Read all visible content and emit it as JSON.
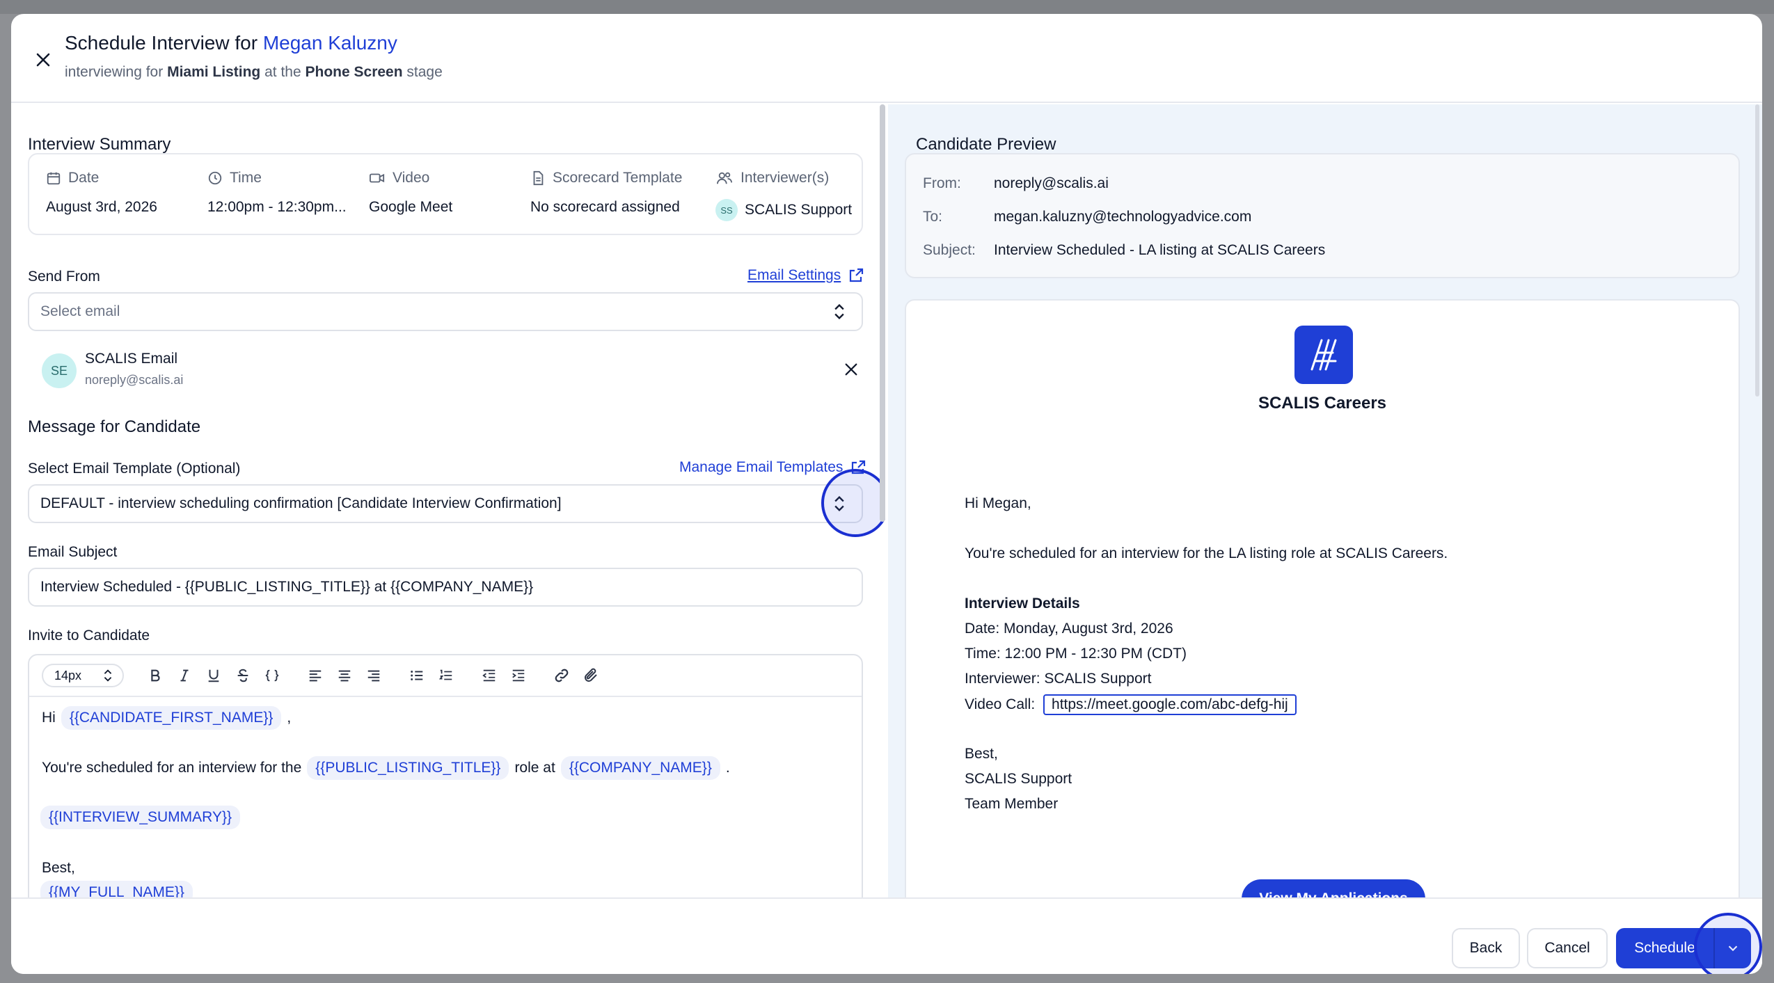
{
  "header": {
    "title_prefix": "Schedule Interview for",
    "candidate_name": "Megan Kaluzny",
    "subtitle_pre": "interviewing for",
    "listing": "Miami Listing",
    "subtitle_mid": "at the",
    "stage": "Phone Screen",
    "subtitle_post": "stage"
  },
  "summary": {
    "title": "Interview Summary",
    "date_label": "Date",
    "date_value": "August 3rd, 2026",
    "time_label": "Time",
    "time_value": "12:00pm - 12:30pm...",
    "video_label": "Video",
    "video_value": "Google Meet",
    "scorecard_label": "Scorecard Template",
    "scorecard_value": "No scorecard assigned",
    "interviewers_label": "Interviewer(s)",
    "interviewer_initials": "SS",
    "interviewer_name": "SCALIS Support"
  },
  "send_from": {
    "label": "Send From",
    "settings_link": "Email Settings",
    "placeholder": "Select email",
    "sender_initials": "SE",
    "sender_name": "SCALIS Email",
    "sender_email": "noreply@scalis.ai"
  },
  "message": {
    "title": "Message for Candidate",
    "template_label": "Select Email Template (Optional)",
    "templates_link": "Manage Email Templates",
    "template_value": "DEFAULT - interview scheduling confirmation [Candidate Interview Confirmation]",
    "subject_label": "Email Subject",
    "subject_value": "Interview Scheduled - {{PUBLIC_LISTING_TITLE}} at {{COMPANY_NAME}}",
    "invite_label": "Invite to Candidate"
  },
  "editor": {
    "font_size": "14px",
    "line1_pre": "Hi",
    "token_first_name": "{{CANDIDATE_FIRST_NAME}}",
    "line1_post": ",",
    "line2_pre": "You're scheduled for an interview for the",
    "token_listing": "{{PUBLIC_LISTING_TITLE}}",
    "line2_mid": "role at",
    "token_company": "{{COMPANY_NAME}}",
    "line2_post": ".",
    "token_summary": "{{INTERVIEW_SUMMARY}}",
    "line_best": "Best,",
    "token_full_name": "{{MY_FULL_NAME}}"
  },
  "preview": {
    "title": "Candidate Preview",
    "from_label": "From:",
    "from_value": "noreply@scalis.ai",
    "to_label": "To:",
    "to_value": "megan.kaluzny@technologyadvice.com",
    "subject_label": "Subject:",
    "subject_value": "Interview Scheduled - LA listing at SCALIS Careers",
    "company": "SCALIS Careers",
    "greeting": "Hi Megan,",
    "intro": "You're scheduled for an interview for the LA listing  role at SCALIS Careers.",
    "details_heading": "Interview Details",
    "details_date": "Date: Monday, August 3rd, 2026",
    "details_time": "Time: 12:00 PM - 12:30 PM (CDT)",
    "details_interviewer": "Interviewer: SCALIS Support",
    "video_label": "Video Call:",
    "video_link": "https://meet.google.com/abc-defg-hij",
    "sign_best": "Best,",
    "sign_name": "SCALIS Support",
    "sign_role": "Team Member",
    "cta": "View My Applications"
  },
  "footer": {
    "back": "Back",
    "cancel": "Cancel",
    "schedule": "Schedule"
  },
  "colors": {
    "accent": "#1f3fd6",
    "backdrop": "#8e9094",
    "preview_bg": "#eef4fb"
  }
}
